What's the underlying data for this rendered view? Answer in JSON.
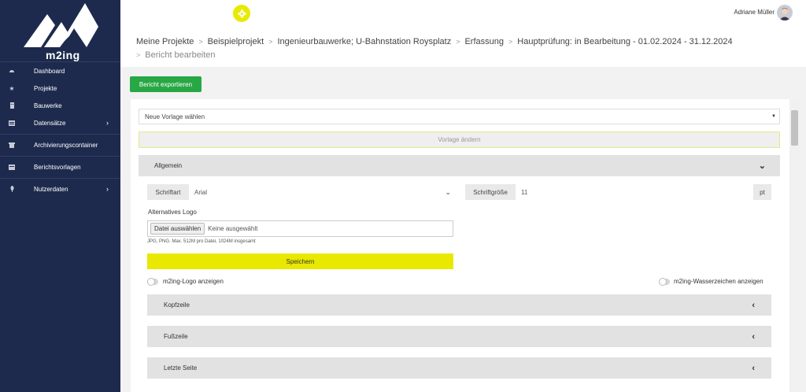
{
  "brand": "m2ing",
  "sidebar": {
    "items": [
      {
        "label": "Dashboard",
        "icon": "dashboard-icon"
      },
      {
        "label": "Projekte",
        "icon": "star-icon"
      },
      {
        "label": "Bauwerke",
        "icon": "building-icon"
      },
      {
        "label": "Datensätze",
        "icon": "table-icon",
        "chevron": "›"
      },
      {
        "label": "Archivierungscontainer",
        "icon": "archive-icon"
      },
      {
        "label": "Berichtsvorlagen",
        "icon": "report-icon"
      },
      {
        "label": "Nutzerdaten",
        "icon": "pin-icon",
        "chevron": "›"
      }
    ]
  },
  "header": {
    "user_name": "Adriane Müller"
  },
  "breadcrumb": {
    "items": [
      "Meine Projekte",
      "Beispielprojekt",
      "Ingenieurbauwerke; U-Bahnstation Roysplatz",
      "Erfassung",
      "Hauptprüfung: in Bearbeitung - 01.02.2024 - 31.12.2024"
    ],
    "current": "Bericht bearbeiten",
    "separator": ">"
  },
  "toolbar": {
    "export_label": "Bericht exportieren"
  },
  "template": {
    "select_value": "Neue Vorlage wählen",
    "change_label": "Vorlage ändern"
  },
  "section_general": {
    "title": "Allgemein",
    "font_label": "Schriftart",
    "font_value": "Arial",
    "size_label": "Schriftgröße",
    "size_value": "11",
    "size_unit": "pt",
    "logo_label": "Alternatives Logo",
    "file_button": "Datei auswählen",
    "file_status": "Keine ausgewählt",
    "file_hint": "JPG, PNG. Max. 512M pro Datei, 1024M insgesamt",
    "save_label": "Speichern",
    "toggle_logo_label": "m2ing-Logo anzeigen",
    "toggle_watermark_label": "m2ing-Wasserzeichen anzeigen"
  },
  "subsections": [
    "Kopfzeile",
    "Fußzeile",
    "Letzte Seite"
  ],
  "colors": {
    "sidebar": "#1e2a4d",
    "accent_yellow": "#e8e800",
    "export_green": "#28a745"
  }
}
